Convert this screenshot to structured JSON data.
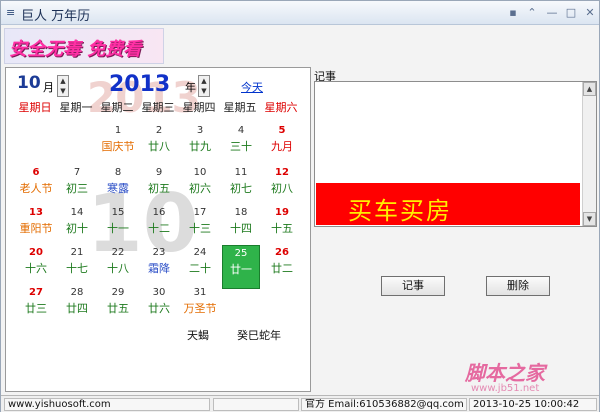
{
  "window": {
    "title": "巨人 万年历"
  },
  "banner": {
    "text": "安全无毒 免费看"
  },
  "calendar": {
    "month": "10",
    "month_unit": "月",
    "year": "2013",
    "year_unit": "年",
    "today_link": "今天",
    "watermark_year": "2013",
    "watermark_month": "10",
    "weekdays": [
      "星期日",
      "星期一",
      "星期二",
      "星期三",
      "星期四",
      "星期五",
      "星期六"
    ],
    "days": [
      {
        "d": "1",
        "l": "国庆节",
        "t": "fest"
      },
      {
        "d": "2",
        "l": "廿八"
      },
      {
        "d": "3",
        "l": "廿九"
      },
      {
        "d": "4",
        "l": "三十"
      },
      {
        "d": "5",
        "l": "九月",
        "t": "red"
      },
      {
        "d": "6",
        "l": "老人节",
        "t": "fest"
      },
      {
        "d": "7",
        "l": "初三"
      },
      {
        "d": "8",
        "l": "寒露",
        "t": "term"
      },
      {
        "d": "9",
        "l": "初五"
      },
      {
        "d": "10",
        "l": "初六"
      },
      {
        "d": "11",
        "l": "初七"
      },
      {
        "d": "12",
        "l": "初八"
      },
      {
        "d": "13",
        "l": "重阳节",
        "t": "fest"
      },
      {
        "d": "14",
        "l": "初十"
      },
      {
        "d": "15",
        "l": "十一"
      },
      {
        "d": "16",
        "l": "十二"
      },
      {
        "d": "17",
        "l": "十三"
      },
      {
        "d": "18",
        "l": "十四"
      },
      {
        "d": "19",
        "l": "十五"
      },
      {
        "d": "20",
        "l": "十六"
      },
      {
        "d": "21",
        "l": "十七"
      },
      {
        "d": "22",
        "l": "十八"
      },
      {
        "d": "23",
        "l": "霜降",
        "t": "term"
      },
      {
        "d": "24",
        "l": "二十"
      },
      {
        "d": "25",
        "l": "廿一",
        "sel": true
      },
      {
        "d": "26",
        "l": "廿二"
      },
      {
        "d": "27",
        "l": "廿三"
      },
      {
        "d": "28",
        "l": "廿四"
      },
      {
        "d": "29",
        "l": "廿五"
      },
      {
        "d": "30",
        "l": "廿六"
      },
      {
        "d": "31",
        "l": "万圣节",
        "t": "fest"
      }
    ],
    "zodiac_sign": "天蝎",
    "ganzhi_year": "癸巳蛇年"
  },
  "notes": {
    "label": "记事",
    "ad_text": "买车买房",
    "record_button": "记事",
    "delete_button": "删除"
  },
  "watermark": {
    "brand": "脚本之家",
    "url": "www.jb51.net"
  },
  "status": {
    "website": "www.yishuosoft.com",
    "email": "官方 Email:610536882@qq.com",
    "datetime": "2013-10-25 10:00:42"
  },
  "colors": {
    "today_cell": "#2fb34a",
    "ad_background": "#ff0000",
    "year_text": "#1131c8"
  }
}
